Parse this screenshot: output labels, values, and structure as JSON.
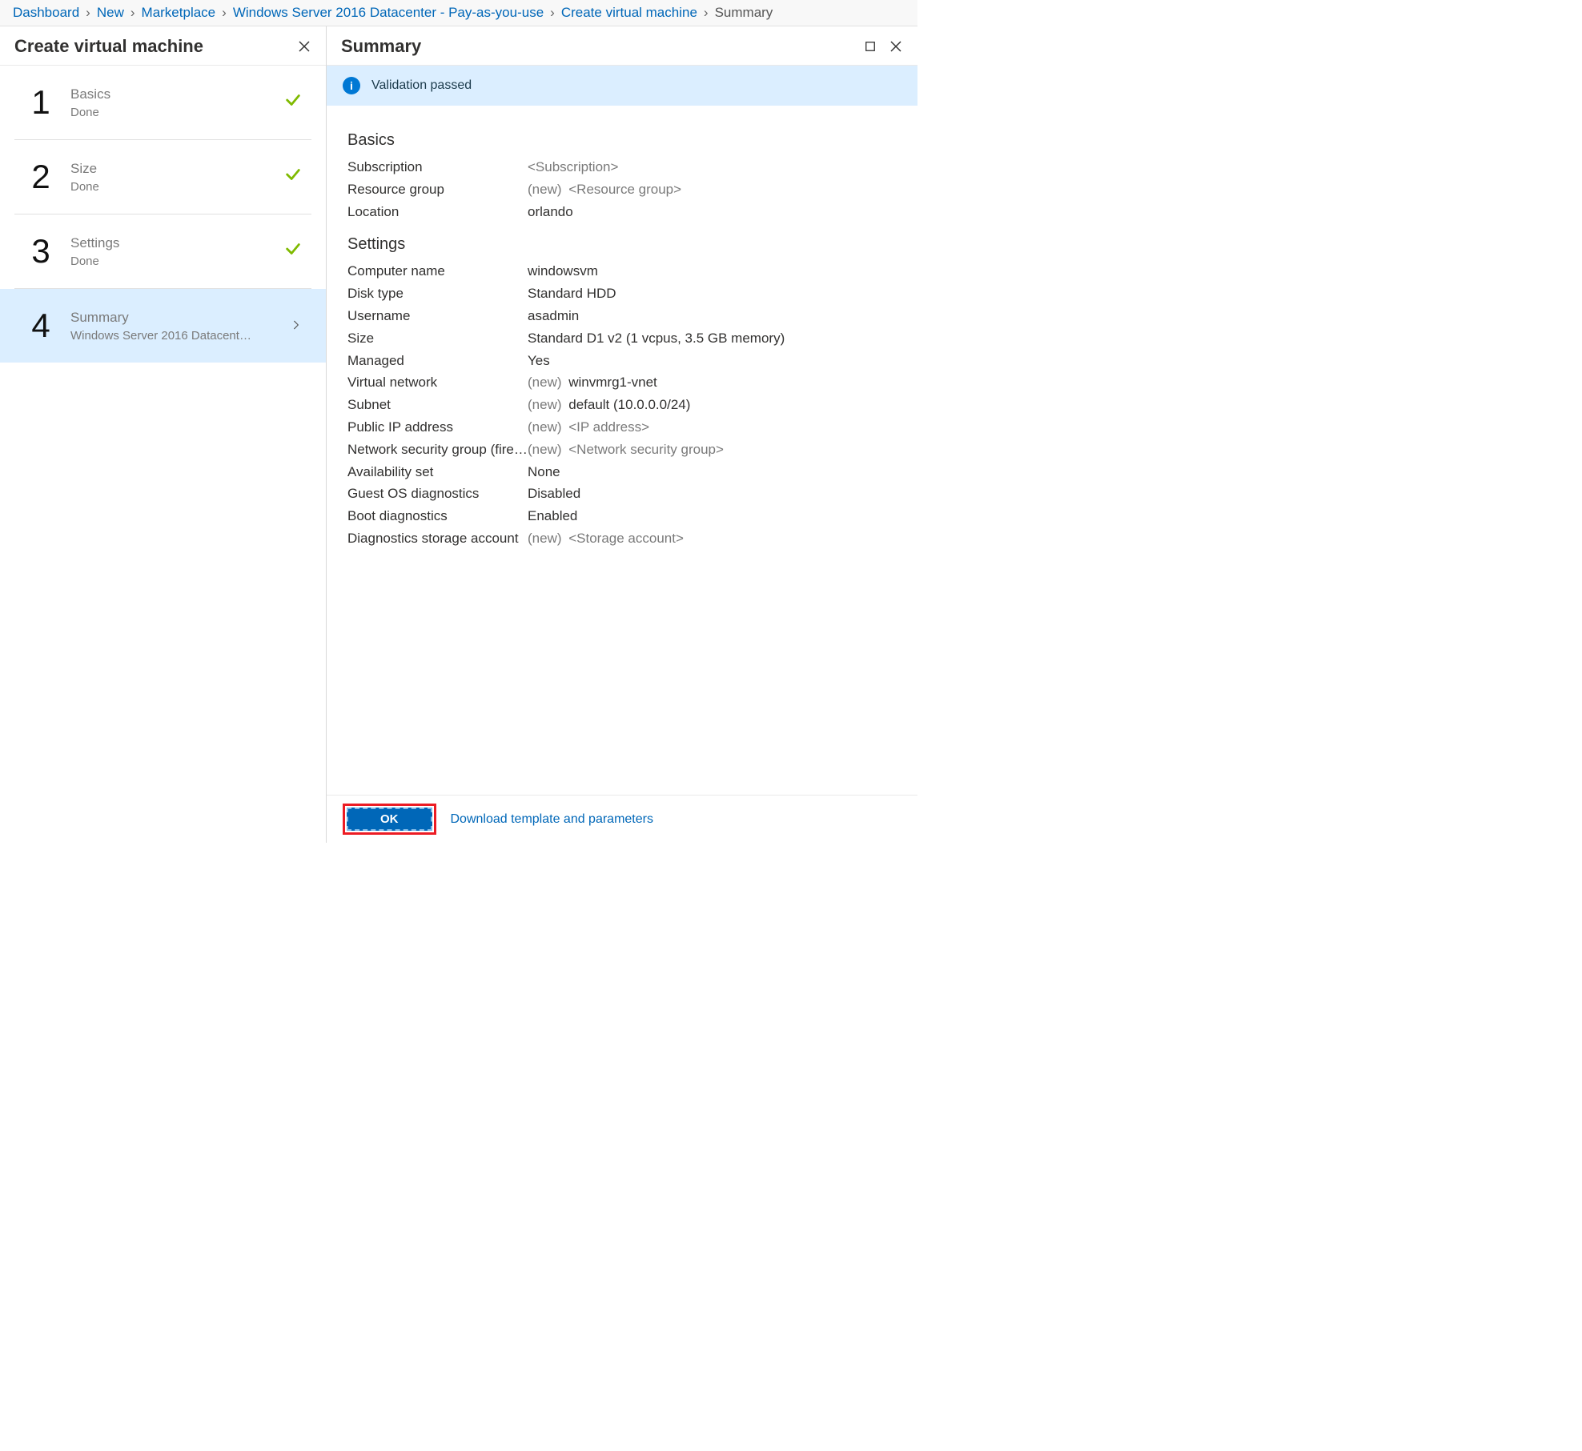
{
  "breadcrumb": {
    "items": [
      {
        "label": "Dashboard",
        "current": false
      },
      {
        "label": "New",
        "current": false
      },
      {
        "label": "Marketplace",
        "current": false
      },
      {
        "label": "Windows Server 2016 Datacenter - Pay-as-you-use",
        "current": false
      },
      {
        "label": "Create virtual machine",
        "current": false
      },
      {
        "label": "Summary",
        "current": true
      }
    ]
  },
  "left_blade": {
    "title": "Create virtual machine",
    "steps": [
      {
        "num": "1",
        "title": "Basics",
        "sub": "Done",
        "done": true,
        "active": false
      },
      {
        "num": "2",
        "title": "Size",
        "sub": "Done",
        "done": true,
        "active": false
      },
      {
        "num": "3",
        "title": "Settings",
        "sub": "Done",
        "done": true,
        "active": false
      },
      {
        "num": "4",
        "title": "Summary",
        "sub": "Windows Server 2016 Datacenter …",
        "done": false,
        "active": true
      }
    ]
  },
  "right_blade": {
    "title": "Summary",
    "validation_text": "Validation passed",
    "sections": {
      "basics": {
        "heading": "Basics",
        "rows": [
          {
            "label": "Subscription",
            "value": "<Subscription>",
            "dim": true,
            "new": false
          },
          {
            "label": "Resource group",
            "value": "<Resource group>",
            "dim": true,
            "new": true
          },
          {
            "label": "Location",
            "value": "orlando",
            "dim": false,
            "new": false
          }
        ]
      },
      "settings": {
        "heading": "Settings",
        "rows": [
          {
            "label": "Computer name",
            "value": "windowsvm",
            "dim": false,
            "new": false
          },
          {
            "label": "Disk type",
            "value": "Standard HDD",
            "dim": false,
            "new": false
          },
          {
            "label": "Username",
            "value": "asadmin",
            "dim": false,
            "new": false
          },
          {
            "label": "Size",
            "value": "Standard D1 v2 (1 vcpus, 3.5 GB memory)",
            "dim": false,
            "new": false
          },
          {
            "label": "Managed",
            "value": "Yes",
            "dim": false,
            "new": false
          },
          {
            "label": "Virtual network",
            "value": "winvmrg1-vnet",
            "dim": false,
            "new": true
          },
          {
            "label": "Subnet",
            "value": "default (10.0.0.0/24)",
            "dim": false,
            "new": true
          },
          {
            "label": "Public IP address",
            "value": "<IP address>",
            "dim": true,
            "new": true
          },
          {
            "label": "Network security group (fire…",
            "value": "<Network security group>",
            "dim": true,
            "new": true
          },
          {
            "label": "Availability set",
            "value": "None",
            "dim": false,
            "new": false
          },
          {
            "label": "Guest OS diagnostics",
            "value": "Disabled",
            "dim": false,
            "new": false
          },
          {
            "label": "Boot diagnostics",
            "value": "Enabled",
            "dim": false,
            "new": false
          },
          {
            "label": "Diagnostics storage account",
            "value": "<Storage account>",
            "dim": true,
            "new": true
          }
        ]
      }
    },
    "footer": {
      "ok_label": "OK",
      "download_label": "Download template and parameters"
    },
    "new_prefix": "(new)"
  }
}
